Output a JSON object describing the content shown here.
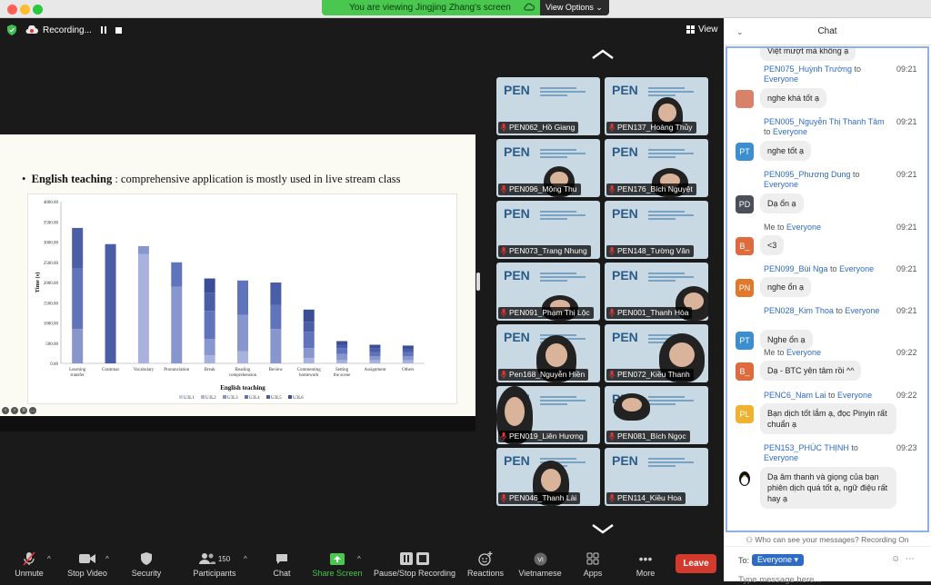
{
  "banner": {
    "viewing_text": "You are viewing Jingjing Zhang's screen",
    "view_options": "View Options"
  },
  "recording": {
    "label": "Recording..."
  },
  "view_button": "View",
  "slide": {
    "bullet_bold": "English teaching",
    "bullet_rest": " : comprehensive application is mostly used in live stream class"
  },
  "chart_data": {
    "type": "bar",
    "stacked": true,
    "ylabel": "Time (s)",
    "xlabel": "English teaching",
    "ylim": [
      0,
      4000
    ],
    "yticks": [
      "0.00",
      "500.00",
      "1000.00",
      "1500.00",
      "2000.00",
      "2500.00",
      "3000.00",
      "3500.00",
      "4000.00"
    ],
    "categories": [
      "Learning transfer",
      "Grammar",
      "Vocabulary",
      "Pronunciation",
      "Break",
      "Reading comprehension",
      "Review",
      "Commenting homework",
      "Setting the scene",
      "Assignment",
      "Others"
    ],
    "series": [
      {
        "name": "U3L1",
        "color": "#c6cbe6",
        "values": [
          0,
          0,
          0,
          0,
          0,
          0,
          0,
          0,
          0,
          0,
          0
        ]
      },
      {
        "name": "U3L2",
        "color": "#a8b2dc",
        "values": [
          0,
          0,
          2700,
          0,
          200,
          300,
          0,
          130,
          80,
          80,
          80
        ]
      },
      {
        "name": "U3L3",
        "color": "#8796cc",
        "values": [
          850,
          0,
          200,
          1900,
          400,
          900,
          850,
          250,
          150,
          100,
          100
        ]
      },
      {
        "name": "U3L4",
        "color": "#6074bb",
        "values": [
          1500,
          0,
          0,
          600,
          700,
          850,
          600,
          400,
          150,
          100,
          100
        ]
      },
      {
        "name": "U3L5",
        "color": "#4a5ea8",
        "values": [
          1000,
          2950,
          0,
          0,
          450,
          0,
          550,
          250,
          80,
          100,
          80
        ]
      },
      {
        "name": "U3L6",
        "color": "#3a4d95",
        "values": [
          0,
          0,
          0,
          0,
          350,
          0,
          0,
          300,
          90,
          80,
          80
        ]
      }
    ],
    "legend_position": "bottom",
    "grid": false
  },
  "participants": [
    {
      "name": "PEN062_Hồ Giang"
    },
    {
      "name": "PEN137_Hoàng Thủy"
    },
    {
      "name": "PEN096_Mộng Thu"
    },
    {
      "name": "PEN176_Bích Nguyệt"
    },
    {
      "name": "PEN073_Trang Nhung"
    },
    {
      "name": "PEN148_Tường Vân"
    },
    {
      "name": "PEN091_Phạm Thị Lộc"
    },
    {
      "name": "PEN001_Thanh Hòa"
    },
    {
      "name": "Pen168_Nguyễn Hiền"
    },
    {
      "name": "PEN072_Kiều Thanh"
    },
    {
      "name": "PEN019_Liên Hương"
    },
    {
      "name": "PEN081_Bích Ngọc"
    },
    {
      "name": "PEN046_Thanh Lài"
    },
    {
      "name": "PEN114_Kiều Hoa"
    }
  ],
  "tile_logo": "PEN",
  "toolbar": {
    "unmute": "Unmute",
    "stop_video": "Stop Video",
    "security": "Security",
    "participants": "Participants",
    "participants_count": "150",
    "chat": "Chat",
    "share_screen": "Share Screen",
    "pause_stop": "Pause/Stop Recording",
    "reactions": "Reactions",
    "vietnamese": "Vietnamese",
    "apps": "Apps",
    "more": "More",
    "leave": "Leave"
  },
  "chat": {
    "title": "Chat",
    "top_partial": "Việt mượt mà không ạ",
    "messages": [
      {
        "sender": "PEN075_Huỳnh Trường",
        "to": " to ",
        "recipient": "Everyone",
        "time": "09:21",
        "text": "nghe khá tốt ạ",
        "avatar": ""
      },
      {
        "sender": "PEN005_Nguyễn Thị Thanh Tâm",
        "to": " to ",
        "recipient": "Everyone",
        "time": "09:21",
        "text": "nghe tốt ạ",
        "avatar": "PT"
      },
      {
        "sender": "PEN095_Phương Dung",
        "to": " to ",
        "recipient": "Everyone",
        "time": "09:21",
        "text": "Dạ ổn ạ",
        "avatar": "PD"
      },
      {
        "sender": "Me",
        "to": " to ",
        "recipient": "Everyone",
        "time": "09:21",
        "text": "<3",
        "avatar": "B_"
      },
      {
        "sender": "PEN099_Bùi Nga",
        "to": " to ",
        "recipient": "Everyone",
        "time": "09:21",
        "text": "nghe ổn ạ",
        "avatar": "PN"
      },
      {
        "sender": "PEN028_Kim Thoa",
        "to": " to ",
        "recipient": "Everyone",
        "time": "09:21",
        "text": "Nghe ổn ạ",
        "avatar": "PT"
      },
      {
        "sender": "Me",
        "to": " to ",
        "recipient": "Everyone",
        "time": "09:22",
        "text": "Dạ - BTC yên tâm rồi ^^",
        "avatar": "B_"
      },
      {
        "sender": "PENC6_Nam Lai",
        "to": " to ",
        "recipient": "Everyone",
        "time": "09:22",
        "text": "Bạn dịch tốt lắm ạ, đọc Pinyin rất chuẩn ạ",
        "avatar": "PL"
      },
      {
        "sender": "PEN153_PHÚC THỊNH",
        "to": " to ",
        "recipient": "Everyone",
        "time": "09:23",
        "text": "Dạ âm thanh và giọng của bạn phiên dịch quá tốt ạ, ngữ điệu rất hay ạ",
        "avatar": ""
      }
    ],
    "who_can_see": "Who can see your messages? Recording On",
    "to_label": "To:",
    "to_value": "Everyone",
    "placeholder": "Type message here..."
  }
}
